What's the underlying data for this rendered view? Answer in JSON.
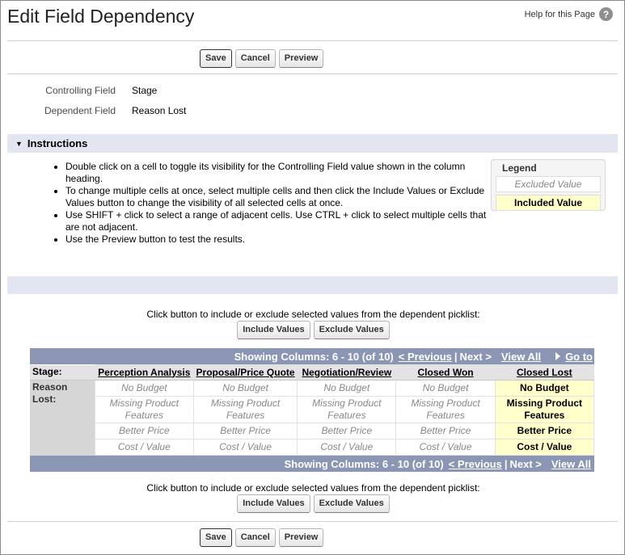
{
  "header": {
    "title": "Edit Field Dependency",
    "help_label": "Help for this Page",
    "help_icon": "?"
  },
  "top_buttons": {
    "save": "Save",
    "cancel": "Cancel",
    "preview": "Preview"
  },
  "fields": {
    "controlling_label": "Controlling Field",
    "controlling_value": "Stage",
    "dependent_label": "Dependent Field",
    "dependent_value": "Reason Lost"
  },
  "instructions": {
    "title": "Instructions",
    "items": [
      "Double click on a cell to toggle its visibility for the Controlling Field value shown in the column heading.",
      "To change multiple cells at once, select multiple cells and then click the Include Values or Exclude Values button to change the visibility of all selected cells at once.",
      "Use SHIFT + click to select a range of adjacent cells. Use CTRL + click to select multiple cells that are not adjacent.",
      "Use the Preview button to test the results."
    ]
  },
  "legend": {
    "title": "Legend",
    "excluded": "Excluded Value",
    "included": "Included Value"
  },
  "value_buttons": {
    "caption": "Click button to include or exclude selected values from the dependent picklist:",
    "include": "Include Values",
    "exclude": "Exclude Values"
  },
  "grid": {
    "pager_top": {
      "showing": "Showing Columns: 6 - 10 (of 10)",
      "previous": "< Previous",
      "next": "Next >",
      "view_all": "View All",
      "goto": "Go to"
    },
    "pager_bottom": {
      "showing": "Showing Columns: 6 - 10 (of 10)",
      "previous": "< Previous",
      "next": "Next >",
      "view_all": "View All"
    },
    "controlling_label": "Stage:",
    "dependent_label": "Reason Lost:",
    "columns": [
      "Perception Analysis",
      "Proposal/Price Quote",
      "Negotiation/Review",
      "Closed Won",
      "Closed Lost"
    ],
    "rows": [
      [
        "No Budget",
        "No Budget",
        "No Budget",
        "No Budget",
        "No Budget"
      ],
      [
        "Missing Product Features",
        "Missing Product Features",
        "Missing Product Features",
        "Missing Product Features",
        "Missing Product Features"
      ],
      [
        "Better Price",
        "Better Price",
        "Better Price",
        "Better Price",
        "Better Price"
      ],
      [
        "Cost / Value",
        "Cost / Value",
        "Cost / Value",
        "Cost / Value",
        "Cost / Value"
      ]
    ],
    "included_column": "Closed Lost"
  },
  "bottom_buttons": {
    "save": "Save",
    "cancel": "Cancel",
    "preview": "Preview"
  },
  "colors": {
    "section_bg": "#e3e6f0",
    "pager_bg": "#8b96b5",
    "included_bg": "#ffffcc"
  }
}
